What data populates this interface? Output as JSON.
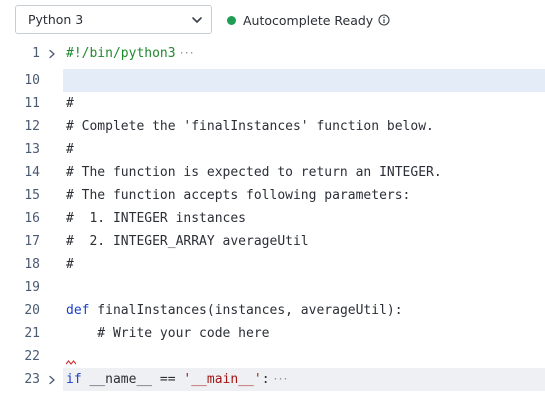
{
  "toolbar": {
    "language_selected": "Python 3",
    "status_text": "Autocomplete Ready",
    "status_color": "#1f9d55",
    "info_icon": "info-circle-icon",
    "dropdown_icon": "chevron-down-icon"
  },
  "editor": {
    "lines": [
      {
        "num": "1",
        "folded": true,
        "text": "#!/bin/python3"
      },
      {
        "num": "10",
        "folded": false,
        "text": ""
      },
      {
        "num": "11",
        "folded": false,
        "text": "#"
      },
      {
        "num": "12",
        "folded": false,
        "text": "# Complete the 'finalInstances' function below."
      },
      {
        "num": "13",
        "folded": false,
        "text": "#"
      },
      {
        "num": "14",
        "folded": false,
        "text": "# The function is expected to return an INTEGER."
      },
      {
        "num": "15",
        "folded": false,
        "text": "# The function accepts following parameters:"
      },
      {
        "num": "16",
        "folded": false,
        "text": "#  1. INTEGER instances"
      },
      {
        "num": "17",
        "folded": false,
        "text": "#  2. INTEGER_ARRAY averageUtil"
      },
      {
        "num": "18",
        "folded": false,
        "text": "#"
      },
      {
        "num": "19",
        "folded": false,
        "text": ""
      },
      {
        "num": "20",
        "folded": false,
        "text": "def finalInstances(instances, averageUtil):"
      },
      {
        "num": "21",
        "folded": false,
        "text": "    # Write your code here"
      },
      {
        "num": "22",
        "folded": false,
        "text": ""
      },
      {
        "num": "23",
        "folded": true,
        "text": "if __name__ == '__main__':"
      }
    ],
    "tokens": {
      "def_kw": "def",
      "def_rest": " finalInstances(instances, averageUtil):",
      "if_kw": "if",
      "if_mid": " __name__ == ",
      "if_str": "'__main__'",
      "if_end": ":"
    },
    "fold_ellipsis": "···",
    "colors": {
      "comment": "#218a2e",
      "keyword": "#1b3fc7",
      "string": "#a31515",
      "line_number": "#4a5a72",
      "current_line": "#e4ecf8"
    }
  }
}
